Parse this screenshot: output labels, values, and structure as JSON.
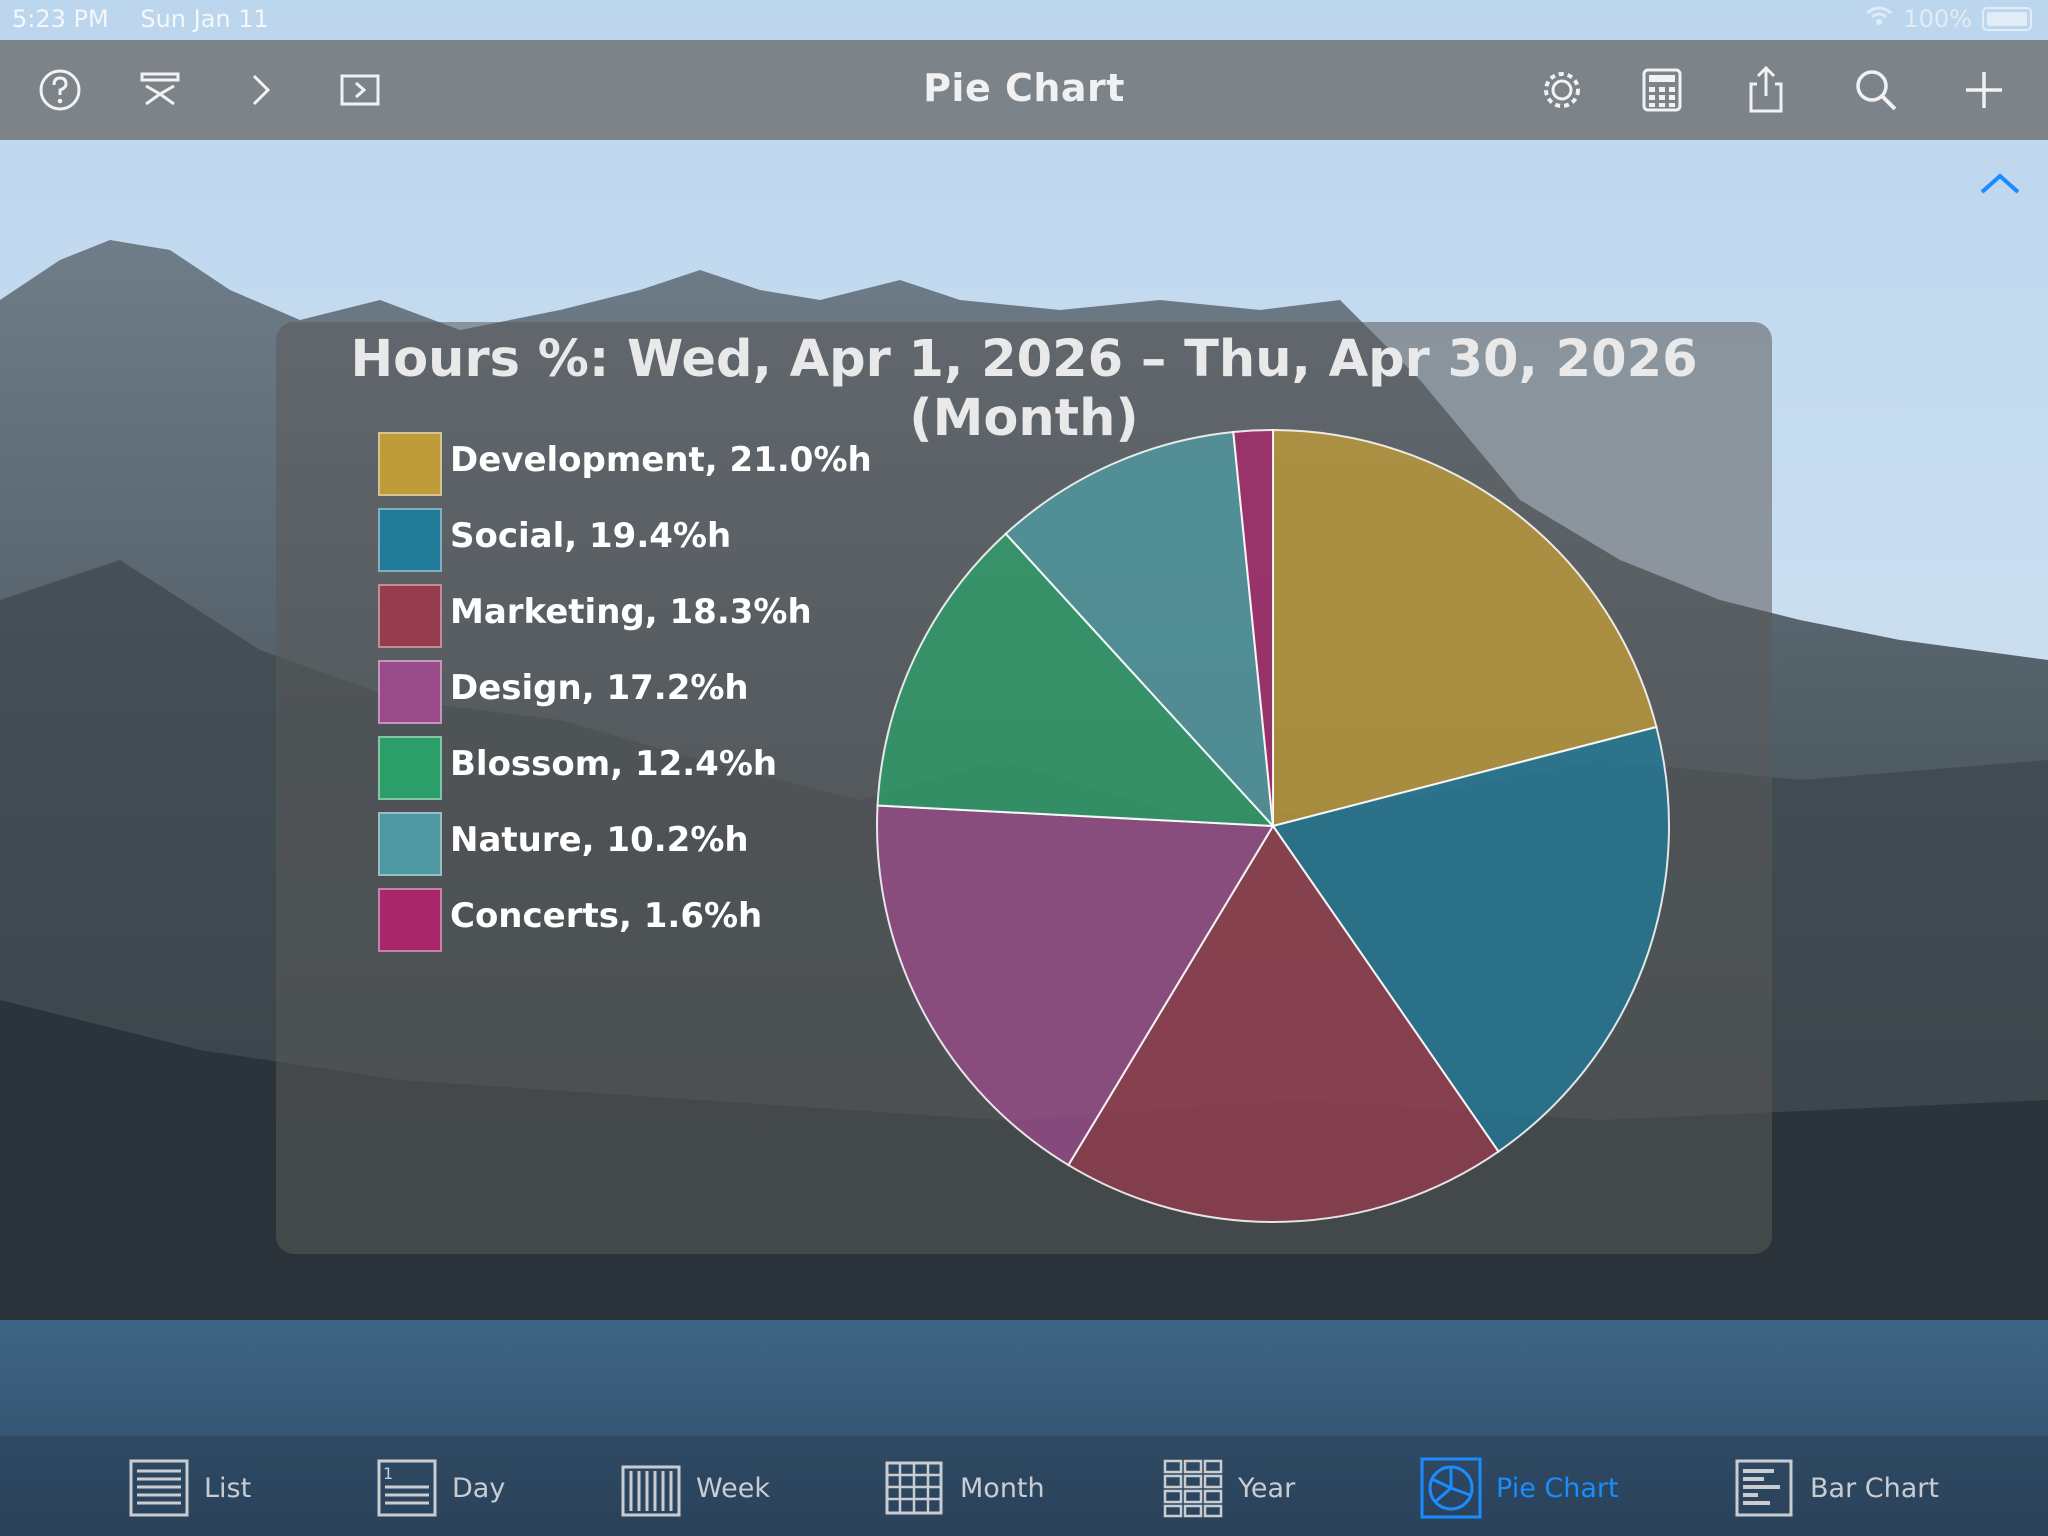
{
  "status_bar": {
    "time": "5:23 PM",
    "date": "Sun Jan 11",
    "battery": "100%"
  },
  "nav": {
    "title": "Pie Chart",
    "left_icons": [
      "help-icon",
      "outline-icon",
      "chevron-right-icon",
      "play-icon"
    ],
    "right_icons": [
      "gear-icon",
      "calculator-icon",
      "share-icon",
      "search-icon",
      "plus-icon"
    ]
  },
  "chart_data": {
    "type": "pie",
    "title": "Hours %: Wed, Apr 1, 2026 – Thu, Apr 30, 2026 (Month)",
    "slices": [
      {
        "label": "Development, 21.0%h",
        "value": 21.0,
        "color": "#c9a135"
      },
      {
        "label": "Social, 19.4%h",
        "value": 19.4,
        "color": "#1d7d9c"
      },
      {
        "label": "Marketing, 18.3%h",
        "value": 18.3,
        "color": "#9c3a4e"
      },
      {
        "label": "Design, 17.2%h",
        "value": 17.2,
        "color": "#a04b8e"
      },
      {
        "label": "Blossom, 12.4%h",
        "value": 12.4,
        "color": "#2aa56b"
      },
      {
        "label": "Nature, 10.2%h",
        "value": 10.2,
        "color": "#4f9fa8"
      },
      {
        "label": "Concerts, 1.6%h",
        "value": 1.6,
        "color": "#b0236c"
      }
    ],
    "legend": "left"
  },
  "tabs": [
    {
      "label": "List",
      "icon": "list-icon",
      "active": false
    },
    {
      "label": "Day",
      "icon": "day-icon",
      "active": false
    },
    {
      "label": "Week",
      "icon": "week-icon",
      "active": false
    },
    {
      "label": "Month",
      "icon": "month-icon",
      "active": false
    },
    {
      "label": "Year",
      "icon": "year-icon",
      "active": false
    },
    {
      "label": "Pie Chart",
      "icon": "pie-chart-icon",
      "active": true
    },
    {
      "label": "Bar Chart",
      "icon": "bar-chart-icon",
      "active": false
    }
  ],
  "colors": {
    "accent": "#1a8cff"
  }
}
